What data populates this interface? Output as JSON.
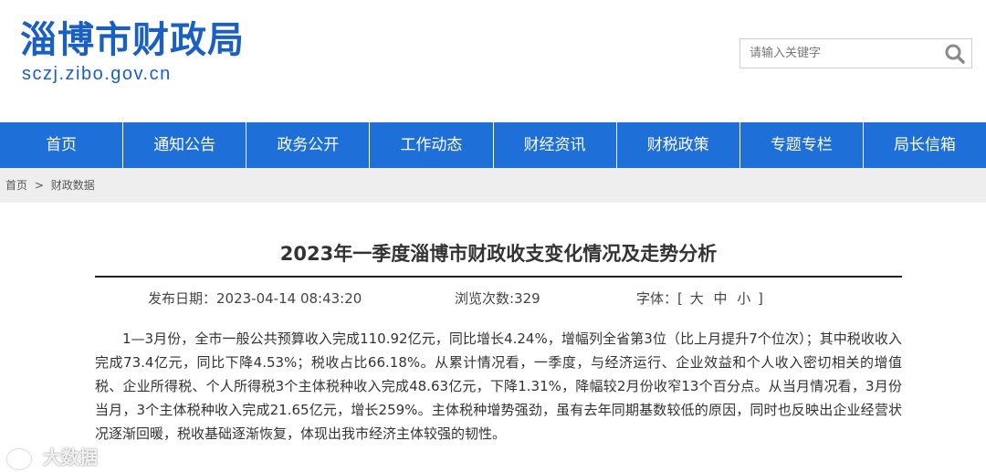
{
  "header": {
    "site_title": "淄博市财政局",
    "site_domain": "sczj.zibo.gov.cn"
  },
  "search": {
    "placeholder": "请输入关键字",
    "icon": "search-icon"
  },
  "nav": {
    "items": [
      {
        "label": "首页"
      },
      {
        "label": "通知公告"
      },
      {
        "label": "政务公开"
      },
      {
        "label": "工作动态"
      },
      {
        "label": "财经资讯"
      },
      {
        "label": "财税政策"
      },
      {
        "label": "专题专栏"
      },
      {
        "label": "局长信箱"
      }
    ]
  },
  "breadcrumb": {
    "home": "首页",
    "separator": ">",
    "current": "财政数据"
  },
  "article": {
    "title": "2023年一季度淄博市财政收支变化情况及走势分析",
    "published": "发布日期：2023-04-14 08:43:20",
    "views": "浏览次数:329",
    "font_label": "字体：[",
    "font_large": "大",
    "font_medium": "中",
    "font_small": "小",
    "font_close": "]",
    "body": "1—3月份，全市一般公共预算收入完成110.92亿元，同比增长4.24%，增幅列全省第3位（比上月提升7个位次）；其中税收收入完成73.4亿元，同比下降4.53%；税收占比66.18%。从累计情况看，一季度，与经济运行、企业效益和个人收入密切相关的增值税、企业所得税、个人所得税3个主体税种收入完成48.63亿元，下降1.31%，降幅较2月份收窄13个百分点。从当月情况看，3月份当月，3个主体税种收入完成21.65亿元，增长259%。主体税种增势强劲，虽有去年同期基数较低的原因，同时也反映出企业经营状况逐渐回暖，税收基础逐渐恢复，体现出我市经济主体较强的韧性。"
  },
  "watermark": {
    "text": "大数据"
  },
  "colors": {
    "brand_blue": "#1a5fc4",
    "nav_blue": "#1f6fd8",
    "breadcrumb_bg": "#eeeeee"
  }
}
